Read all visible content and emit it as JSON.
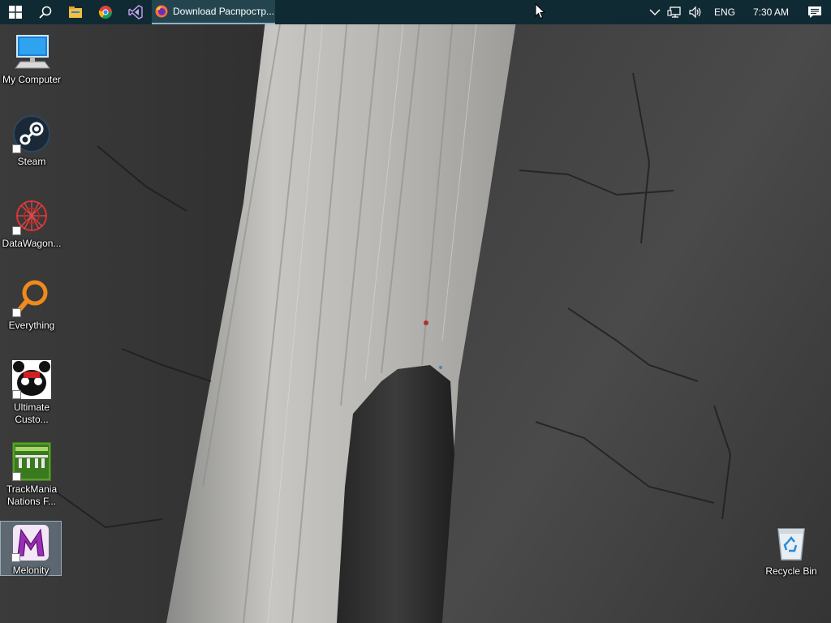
{
  "taskbar": {
    "window_button_label": "Download Распростр...",
    "tray": {
      "language": "ENG",
      "clock": "7:30 AM"
    },
    "icons": {
      "start": "windows-logo-icon",
      "search": "search-icon",
      "explorer": "file-explorer-icon",
      "chrome": "chrome-icon",
      "visual_studio": "visual-studio-icon",
      "firefox": "firefox-icon",
      "overflow": "chevron-up-icon",
      "network": "network-icon",
      "volume": "speaker-icon",
      "notifications": "action-center-icon"
    }
  },
  "desktop": {
    "icons": [
      {
        "label": "My Computer",
        "icon": "computer-icon"
      },
      {
        "label": "Steam",
        "icon": "steam-icon"
      },
      {
        "label": "DataWagon...",
        "icon": "datawagon-icon"
      },
      {
        "label": "Everything",
        "icon": "everything-search-icon"
      },
      {
        "label": "Ultimate Custo...",
        "icon": "ucn-icon"
      },
      {
        "label": "TrackMania Nations F...",
        "icon": "trackmania-icon"
      },
      {
        "label": "Melonity",
        "icon": "melonity-icon"
      },
      {
        "label": "Recycle Bin",
        "icon": "recycle-bin-icon"
      }
    ]
  },
  "colors": {
    "taskbar_bg": "#102a34",
    "active_indicator": "#8fb2c4"
  }
}
